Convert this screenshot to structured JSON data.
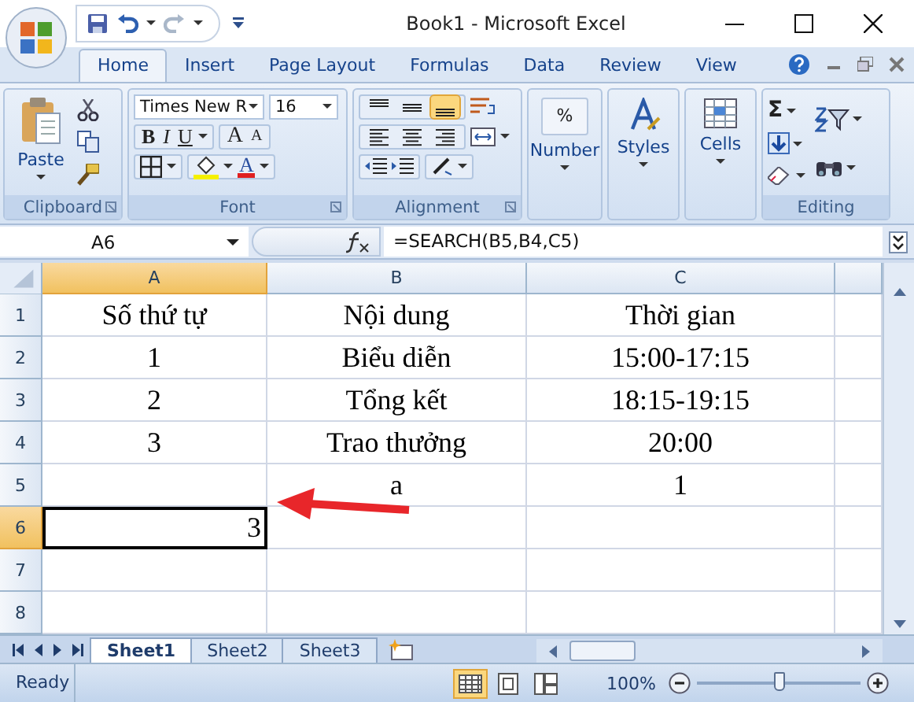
{
  "window": {
    "title": "Book1 - Microsoft Excel"
  },
  "tabs": [
    {
      "label": "Home",
      "selected": true
    },
    {
      "label": "Insert",
      "selected": false
    },
    {
      "label": "Page Layout",
      "selected": false
    },
    {
      "label": "Formulas",
      "selected": false
    },
    {
      "label": "Data",
      "selected": false
    },
    {
      "label": "Review",
      "selected": false
    },
    {
      "label": "View",
      "selected": false
    }
  ],
  "ribbon": {
    "clipboard": {
      "label": "Clipboard",
      "paste": "Paste"
    },
    "font": {
      "label": "Font",
      "font_name": "Times New R",
      "font_size": "16",
      "bold": "B",
      "italic": "I",
      "underline": "U",
      "grow": "A",
      "shrink": "A",
      "font_color": "A"
    },
    "alignment": {
      "label": "Alignment",
      "vertical": [
        {
          "kind": "top",
          "selected": false
        },
        {
          "kind": "middle",
          "selected": false
        },
        {
          "kind": "bottom",
          "selected": true
        }
      ],
      "horizontal": [
        {
          "kind": "left",
          "selected": false
        },
        {
          "kind": "center",
          "selected": false
        },
        {
          "kind": "right",
          "selected": false
        }
      ]
    },
    "number": {
      "button": "Number",
      "symbol": "%"
    },
    "styles": {
      "button": "Styles"
    },
    "cells": {
      "button": "Cells"
    },
    "editing": {
      "label": "Editing",
      "sum": "Σ"
    }
  },
  "formula_bar": {
    "name_box": "A6",
    "formula": "=SEARCH(B5,B4,C5)"
  },
  "sheet": {
    "columns": [
      {
        "label": "A",
        "selected": true
      },
      {
        "label": "B",
        "selected": false
      },
      {
        "label": "C",
        "selected": false
      }
    ],
    "rows": [
      {
        "number": "1",
        "selected": false,
        "cells": [
          "Số thứ tự",
          "Nội dung",
          "Thời gian"
        ]
      },
      {
        "number": "2",
        "selected": false,
        "cells": [
          "1",
          "Biểu diễn",
          "15:00-17:15"
        ]
      },
      {
        "number": "3",
        "selected": false,
        "cells": [
          "2",
          "Tổng kết",
          "18:15-19:15"
        ]
      },
      {
        "number": "4",
        "selected": false,
        "cells": [
          "3",
          "Trao thưởng",
          "20:00"
        ]
      },
      {
        "number": "5",
        "selected": false,
        "cells": [
          "",
          "a",
          "1"
        ]
      },
      {
        "number": "6",
        "selected": true,
        "cells": [
          "3",
          "",
          ""
        ]
      },
      {
        "number": "7",
        "selected": false,
        "cells": [
          "",
          "",
          ""
        ]
      },
      {
        "number": "8",
        "selected": false,
        "cells": [
          "",
          "",
          ""
        ]
      }
    ]
  },
  "sheet_tabs": [
    {
      "label": "Sheet1",
      "selected": true
    },
    {
      "label": "Sheet2",
      "selected": false
    },
    {
      "label": "Sheet3",
      "selected": false
    }
  ],
  "status_bar": {
    "status": "Ready",
    "views": [
      {
        "kind": "normal",
        "selected": true
      },
      {
        "kind": "layout",
        "selected": false
      },
      {
        "kind": "break",
        "selected": false
      }
    ],
    "zoom": "100%",
    "zoom_slider": {
      "level": 0.5
    }
  }
}
